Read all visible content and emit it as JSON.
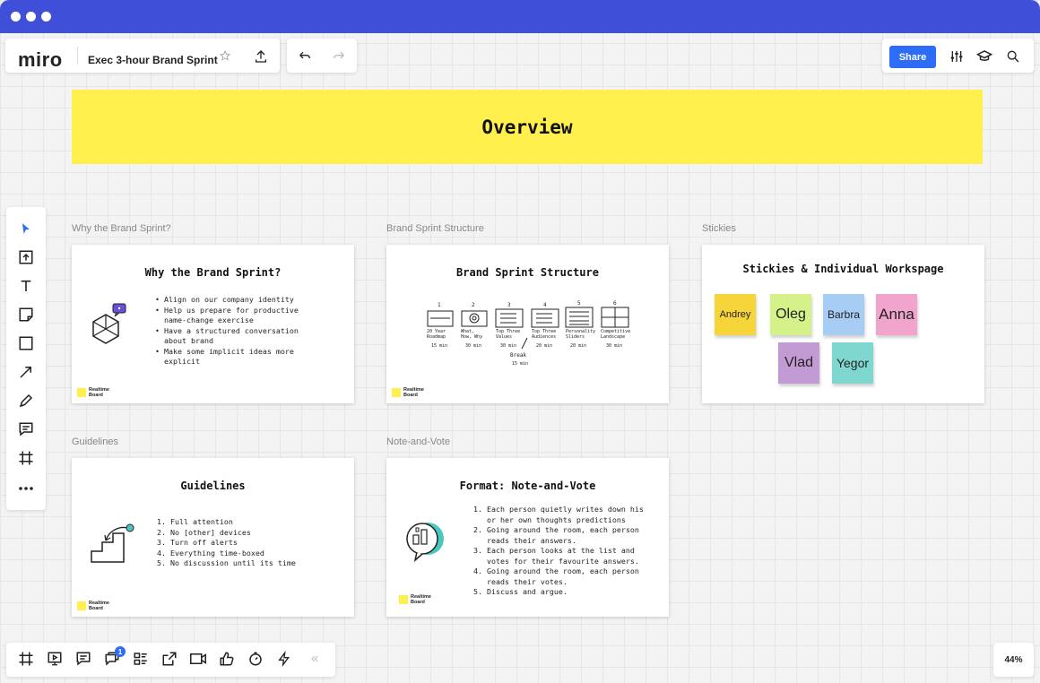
{
  "window": {
    "traffic_lights": [
      "dot",
      "dot",
      "dot"
    ]
  },
  "header": {
    "logo": "miro",
    "board_name": "Exec 3-hour Brand Sprint",
    "icons": [
      "star-icon",
      "upload-icon",
      "undo-icon",
      "redo-icon"
    ],
    "share_label": "Share",
    "right_icons": [
      "settings-sliders-icon",
      "learning-cap-icon",
      "search-icon"
    ]
  },
  "banner": {
    "title": "Overview",
    "color": "#fff04d"
  },
  "frames": [
    {
      "label": "Why the Brand Sprint?",
      "title": "Why the Brand Sprint?",
      "bullets": "• Align on our company identity\n• Help us prepare for productive\n  name-change exercise\n• Have a structured conversation\n  about brand\n• Make some implicit ideas more\n  explicit",
      "logo_text": "Realtime Board"
    },
    {
      "label": "Brand Sprint Structure",
      "title": "Brand Sprint Structure",
      "logo_text": "Realtime Board",
      "sketch_numbers": [
        "1",
        "2",
        "3",
        "4",
        "5",
        "6"
      ],
      "sketch_captions": [
        "20 Year Roadmap",
        "What, How, Why",
        "Top Three Values",
        "Top Three Audiences",
        "Personality Sliders",
        "Competitive Landscape"
      ],
      "sketch_times": [
        "15 min",
        "30 min",
        "30 min",
        "20 min",
        "20 min",
        "30 min"
      ],
      "break_label": "Break",
      "break_time": "15 min"
    },
    {
      "label": "Stickies",
      "title": "Stickies & Individual Workspage",
      "stickies": [
        {
          "name": "Andrey",
          "color": "#f6d53b"
        },
        {
          "name": "Oleg",
          "color": "#d5f28a"
        },
        {
          "name": "Barbra",
          "color": "#a7cdf5"
        },
        {
          "name": "Anna",
          "color": "#f2a5cc"
        },
        {
          "name": "Vlad",
          "color": "#c39bd4"
        },
        {
          "name": "Yegor",
          "color": "#7fd8cf"
        }
      ]
    },
    {
      "label": "Guidelines",
      "title": "Guidelines",
      "items": "1. Full attention\n2. No [other] devices\n3. Turn off alerts\n4. Everything time-boxed\n5. No discussion until its time",
      "logo_text": "Realtime Board"
    },
    {
      "label": "Note-and-Vote",
      "title": "Format: Note-and-Vote",
      "items": "1. Each person quietly writes down his\n   or her own thoughts predictions\n2. Going around the room, each person\n   reads their answers.\n3. Each person looks at the list and\n   votes for their favourite answers.\n4. Going around the room, each person\n   reads their votes.\n5. Discuss and argue.",
      "logo_text": "Realtime Board"
    }
  ],
  "left_toolbar": [
    "select-cursor-icon",
    "upload-content-icon",
    "text-tool-icon",
    "sticky-note-icon",
    "shape-icon",
    "arrow-line-icon",
    "pen-icon",
    "comment-icon",
    "frame-icon",
    "more-icon"
  ],
  "bottom_toolbar": {
    "tools": [
      "frames-icon",
      "presentation-icon",
      "comments-icon",
      "chat-icon",
      "card-list-icon",
      "share-screen-icon",
      "video-call-icon",
      "voting-icon",
      "timer-icon",
      "lightning-icon"
    ],
    "chat_badge": "1",
    "collapse_icon": "double-chevron-left-icon"
  },
  "zoom": {
    "label": "44%"
  },
  "accent": "#2d6df6",
  "titlebar_color": "#3f4fd8"
}
